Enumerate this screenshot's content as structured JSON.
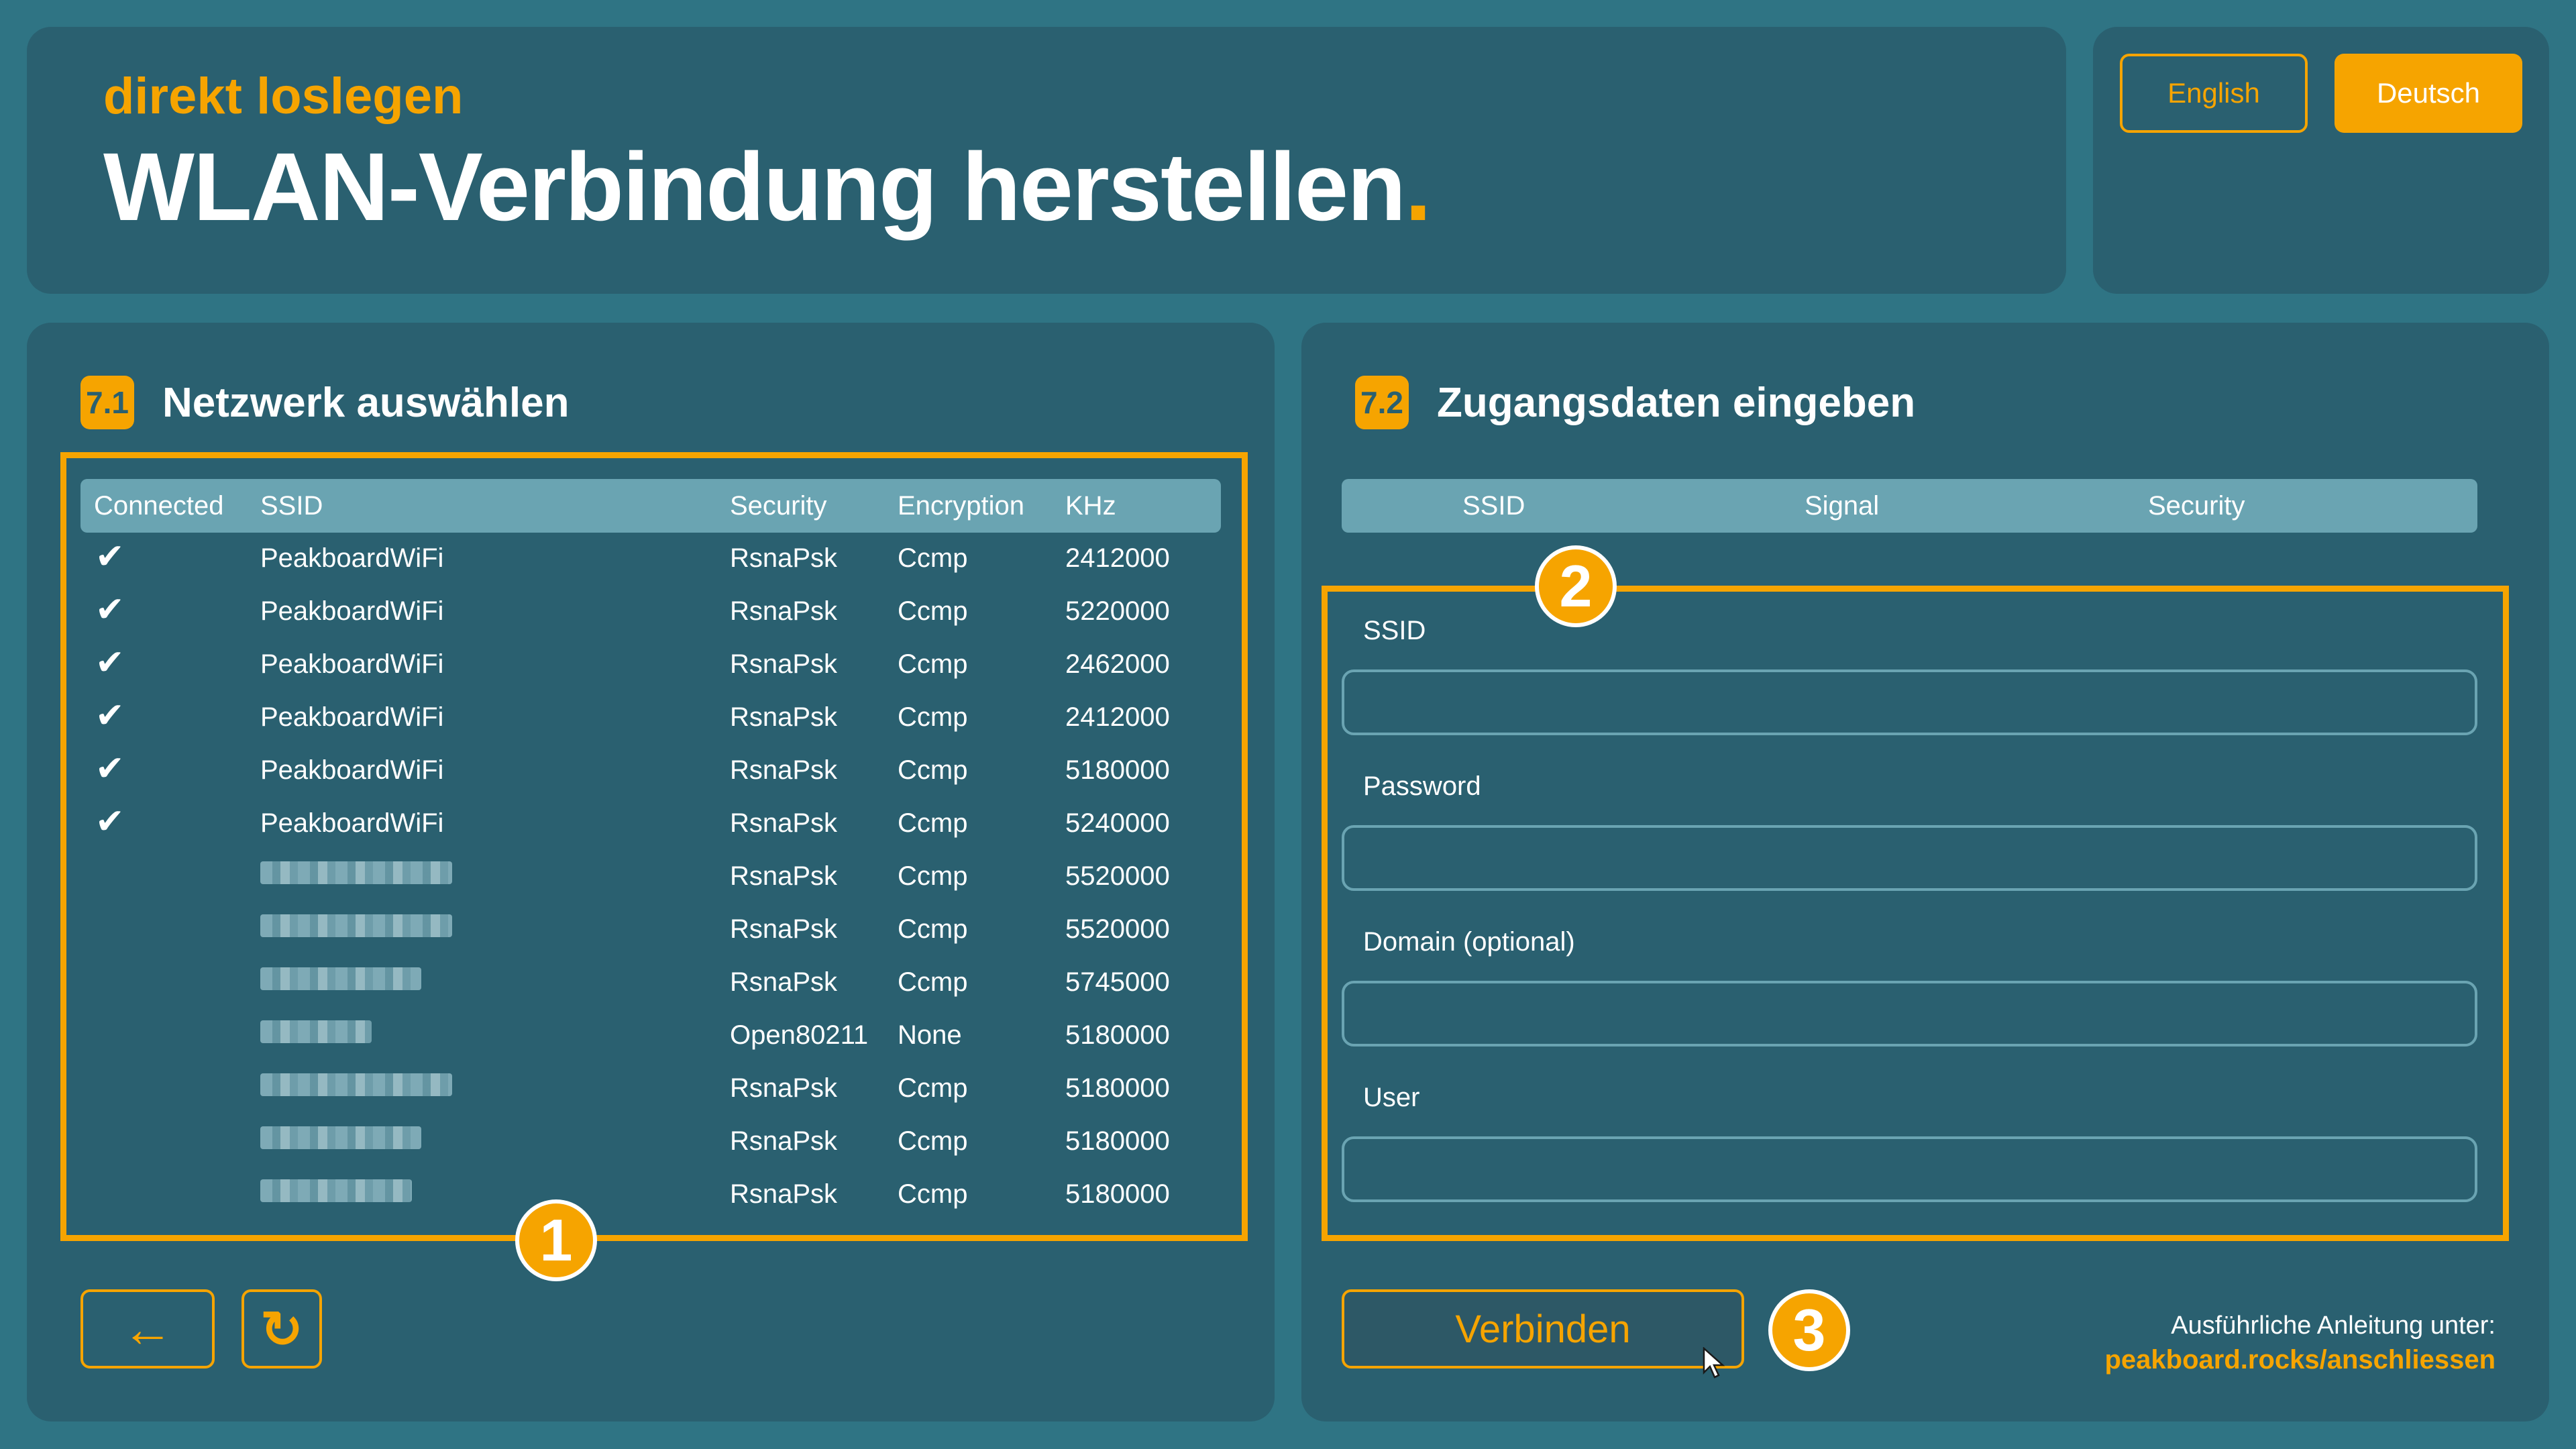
{
  "header": {
    "eyebrow": "direkt loslegen",
    "title": "WLAN-Verbindung herstellen",
    "title_dot": "."
  },
  "language": {
    "english_label": "English",
    "deutsch_label": "Deutsch",
    "selected": "Deutsch"
  },
  "network_section": {
    "number": "7.1",
    "title": "Netzwerk auswählen",
    "badge": "1",
    "columns": [
      "Connected",
      "SSID",
      "Security",
      "Encryption",
      "KHz"
    ],
    "rows": [
      {
        "connected": "✔",
        "ssid": "PeakboardWiFi",
        "security": "RsnaPsk",
        "encryption": "Ccmp",
        "khz": "2412000"
      },
      {
        "connected": "✔",
        "ssid": "PeakboardWiFi",
        "security": "RsnaPsk",
        "encryption": "Ccmp",
        "khz": "5220000"
      },
      {
        "connected": "✔",
        "ssid": "PeakboardWiFi",
        "security": "RsnaPsk",
        "encryption": "Ccmp",
        "khz": "2462000"
      },
      {
        "connected": "✔",
        "ssid": "PeakboardWiFi",
        "security": "RsnaPsk",
        "encryption": "Ccmp",
        "khz": "2412000"
      },
      {
        "connected": "✔",
        "ssid": "PeakboardWiFi",
        "security": "RsnaPsk",
        "encryption": "Ccmp",
        "khz": "5180000"
      },
      {
        "connected": "✔",
        "ssid": "PeakboardWiFi",
        "security": "RsnaPsk",
        "encryption": "Ccmp",
        "khz": "5240000"
      },
      {
        "connected": "",
        "ssid": "",
        "security": "RsnaPsk",
        "encryption": "Ccmp",
        "khz": "5520000"
      },
      {
        "connected": "",
        "ssid": "",
        "security": "RsnaPsk",
        "encryption": "Ccmp",
        "khz": "5520000"
      },
      {
        "connected": "",
        "ssid": "",
        "security": "RsnaPsk",
        "encryption": "Ccmp",
        "khz": "5745000"
      },
      {
        "connected": "",
        "ssid": "",
        "security": "Open80211",
        "encryption": "None",
        "khz": "5180000"
      },
      {
        "connected": "",
        "ssid": "",
        "security": "RsnaPsk",
        "encryption": "Ccmp",
        "khz": "5180000"
      },
      {
        "connected": "",
        "ssid": "",
        "security": "RsnaPsk",
        "encryption": "Ccmp",
        "khz": "5180000"
      },
      {
        "connected": "",
        "ssid": "",
        "security": "RsnaPsk",
        "encryption": "Ccmp",
        "khz": "5180000"
      }
    ]
  },
  "credentials_section": {
    "number": "7.2",
    "title": "Zugangsdaten eingeben",
    "badge": "2",
    "columns": [
      "SSID",
      "Signal",
      "Security"
    ],
    "fields": {
      "ssid_label": "SSID",
      "ssid_value": "",
      "password_label": "Password",
      "password_value": "",
      "domain_label": "Domain (optional)",
      "domain_value": "",
      "user_label": "User",
      "user_value": ""
    }
  },
  "actions": {
    "back_icon": "←",
    "refresh_icon": "↻",
    "connect_label": "Verbinden",
    "connect_badge": "3"
  },
  "footer": {
    "line1": "Ausführliche Anleitung unter:",
    "link": "peakboard.rocks/anschliessen"
  },
  "colors": {
    "background": "#2f7484",
    "panel": "#2a6070",
    "accent": "#f6a400",
    "table_header": "#6aa4b2"
  }
}
